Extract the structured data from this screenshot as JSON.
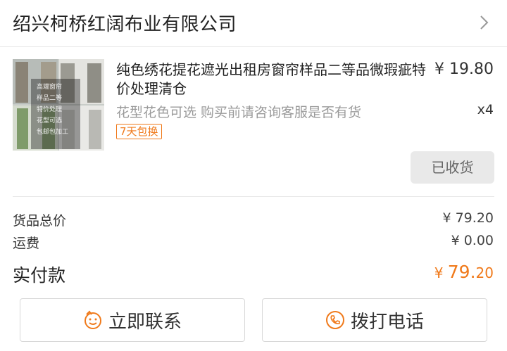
{
  "shop": {
    "name": "绍兴柯桥红阔布业有限公司"
  },
  "product": {
    "title": "纯色绣花提花遮光出租房窗帘样品二等品微瑕疵特价处理清仓",
    "price": "¥ 19.80",
    "spec": "花型花色可选 购买前请咨询客服是否有货",
    "quantity": "x4",
    "tag": "7天包换",
    "status_label": "已收货",
    "thumb_lines": [
      "高端窗帘",
      "样品二等",
      "特价处理",
      "花型可选",
      "包邮包加工"
    ]
  },
  "summary": {
    "goods_label": "货品总价",
    "goods_value": "¥ 79.20",
    "shipping_label": "运费",
    "shipping_value": "¥ 0.00",
    "total_label": "实付款",
    "total_currency": "¥",
    "total_int": "79.",
    "total_dec": "20"
  },
  "actions": {
    "contact_label": "立即联系",
    "call_label": "拨打电话"
  },
  "colors": {
    "accent": "#f07a1b"
  }
}
